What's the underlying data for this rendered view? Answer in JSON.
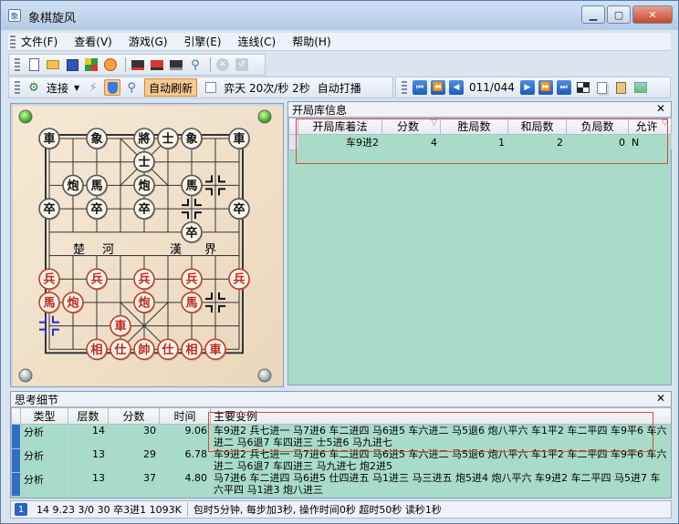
{
  "window": {
    "title": "象棋旋风",
    "app_icon": "象"
  },
  "menu": [
    "文件(F)",
    "查看(V)",
    "游戏(G)",
    "引擎(E)",
    "连线(C)",
    "帮助(H)"
  ],
  "toolbar2": {
    "connect_label": "连接",
    "auto_refresh_label": "自动刷新",
    "speed_label": "弈天 20次/秒 2秒",
    "auto_play_label": "自动打播",
    "move_counter": "011/044"
  },
  "board": {
    "river_left_1": "楚",
    "river_left_2": "河",
    "river_right_1": "漢",
    "river_right_2": "界",
    "black_pieces": [
      {
        "label": "車",
        "col": 0,
        "row": 0
      },
      {
        "label": "象",
        "col": 2,
        "row": 0
      },
      {
        "label": "將",
        "col": 4,
        "row": 0
      },
      {
        "label": "士",
        "col": 5,
        "row": 0
      },
      {
        "label": "象",
        "col": 6,
        "row": 0
      },
      {
        "label": "車",
        "col": 8,
        "row": 0
      },
      {
        "label": "士",
        "col": 4,
        "row": 1
      },
      {
        "label": "炮",
        "col": 1,
        "row": 2
      },
      {
        "label": "馬",
        "col": 2,
        "row": 2
      },
      {
        "label": "炮",
        "col": 4,
        "row": 2
      },
      {
        "label": "馬",
        "col": 6,
        "row": 2
      },
      {
        "label": "卒",
        "col": 0,
        "row": 3
      },
      {
        "label": "卒",
        "col": 2,
        "row": 3
      },
      {
        "label": "卒",
        "col": 4,
        "row": 3
      },
      {
        "label": "卒",
        "col": 8,
        "row": 3
      },
      {
        "label": "卒",
        "col": 6,
        "row": 4
      }
    ],
    "red_pieces": [
      {
        "label": "兵",
        "col": 0,
        "row": 6
      },
      {
        "label": "兵",
        "col": 2,
        "row": 6
      },
      {
        "label": "兵",
        "col": 4,
        "row": 6
      },
      {
        "label": "兵",
        "col": 6,
        "row": 6
      },
      {
        "label": "兵",
        "col": 8,
        "row": 6
      },
      {
        "label": "馬",
        "col": 0,
        "row": 7
      },
      {
        "label": "炮",
        "col": 1,
        "row": 7
      },
      {
        "label": "炮",
        "col": 4,
        "row": 7
      },
      {
        "label": "馬",
        "col": 6,
        "row": 7
      },
      {
        "label": "車",
        "col": 3,
        "row": 8
      },
      {
        "label": "相",
        "col": 2,
        "row": 9
      },
      {
        "label": "仕",
        "col": 3,
        "row": 9
      },
      {
        "label": "帥",
        "col": 4,
        "row": 9
      },
      {
        "label": "仕",
        "col": 5,
        "row": 9
      },
      {
        "label": "相",
        "col": 6,
        "row": 9
      },
      {
        "label": "車",
        "col": 7,
        "row": 9
      }
    ]
  },
  "opening": {
    "title": "开局库信息",
    "columns": [
      "开局库着法",
      "分数",
      "胜局数",
      "和局数",
      "负局数",
      "允许"
    ],
    "rows": [
      {
        "move": "车9进2",
        "score": "4",
        "wins": "1",
        "draws": "2",
        "losses": "0",
        "allow": "N"
      }
    ]
  },
  "analysis": {
    "title": "思考细节",
    "columns": [
      "类型",
      "层数",
      "分数",
      "时间",
      "主要变例"
    ],
    "rows": [
      {
        "type": "分析",
        "depth": "14",
        "score": "30",
        "time": "9.06",
        "pv": "车9进2 兵七进一 马7进6 车二进四 马6进5 车六进二 马5退6 炮八平六 车1平2 车二平四 车9平6 车六进二 马6退7 车四进三 士5进6 马九进七"
      },
      {
        "type": "分析",
        "depth": "13",
        "score": "29",
        "time": "6.78",
        "pv": "车9进2 兵七进一 马7进6 车二进四 马6进5 车六进二 马5退6 炮八平六 车1平2 车二平四 车9平6 车六进二 马6退7 车四进三 马九进七 炮2进5"
      },
      {
        "type": "分析",
        "depth": "13",
        "score": "37",
        "time": "4.80",
        "pv": "马7进6 车二进四 马6进5 仕四进五 马1进三 马三进五 炮5进4 炮八平六 车9进2 车二平四 马5进7 车六平四 马1进3 炮八进三"
      }
    ]
  },
  "status": {
    "badge": "1",
    "engine_info": "14 9.23 3/0 30 卒3进1 1093K",
    "time_control": "包时5分钟, 每步加3秒, 操作时间0秒  超时50秒  读秒1秒"
  }
}
